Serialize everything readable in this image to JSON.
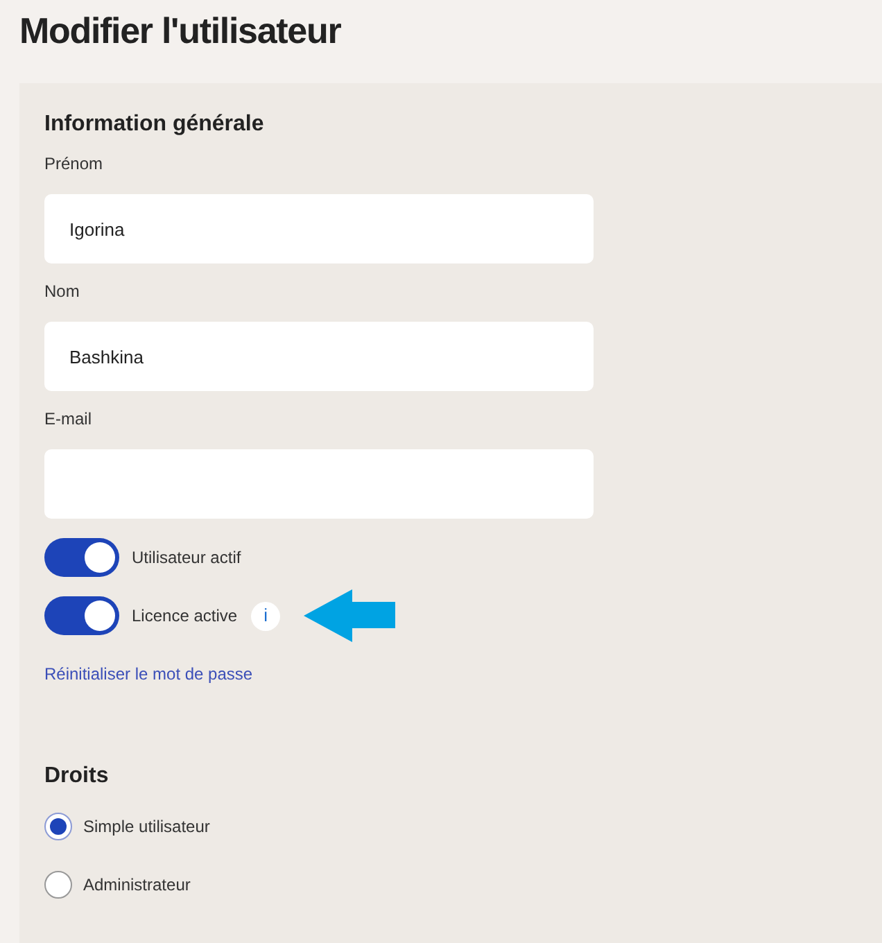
{
  "title": "Modifier l'utilisateur",
  "general": {
    "heading": "Information générale",
    "fields": [
      {
        "label": "Prénom",
        "value": "Igorina"
      },
      {
        "label": "Nom",
        "value": "Bashkina"
      },
      {
        "label": "E-mail"
      }
    ],
    "toggles": [
      {
        "label": "Utilisateur actif",
        "on": true
      },
      {
        "label": "Licence active",
        "on": true,
        "info": "i",
        "pointer_arrow": true
      }
    ],
    "reset_link": "Réinitialiser le mot de passe"
  },
  "rights": {
    "heading": "Droits",
    "options": [
      {
        "label": "Simple utilisateur",
        "selected": true
      },
      {
        "label": "Administrateur",
        "selected": false
      }
    ]
  }
}
